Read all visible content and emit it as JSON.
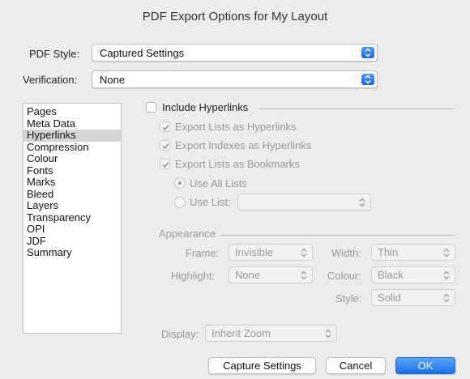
{
  "window": {
    "title": "PDF Export Options for My Layout"
  },
  "pdf_style": {
    "label": "PDF Style:",
    "value": "Captured Settings"
  },
  "verification": {
    "label": "Verification:",
    "value": "None"
  },
  "sidebar": {
    "items": [
      {
        "label": "Pages",
        "selected": false
      },
      {
        "label": "Meta Data",
        "selected": false
      },
      {
        "label": "Hyperlinks",
        "selected": true
      },
      {
        "label": "Compression",
        "selected": false
      },
      {
        "label": "Colour",
        "selected": false
      },
      {
        "label": "Fonts",
        "selected": false
      },
      {
        "label": "Marks",
        "selected": false
      },
      {
        "label": "Bleed",
        "selected": false
      },
      {
        "label": "Layers",
        "selected": false
      },
      {
        "label": "Transparency",
        "selected": false
      },
      {
        "label": "OPI",
        "selected": false
      },
      {
        "label": "JDF",
        "selected": false
      },
      {
        "label": "Summary",
        "selected": false
      }
    ]
  },
  "hyperlinks": {
    "include_label": "Include Hyperlinks",
    "include_checked": false,
    "export_lists_label": "Export Lists as Hyperlinks",
    "export_indexes_label": "Export Indexes as Hyperlinks",
    "export_bookmarks_label": "Export Lists as Bookmarks",
    "use_all_lists_label": "Use All Lists",
    "use_list_label": "Use List:",
    "use_list_value": ""
  },
  "appearance": {
    "section_label": "Appearance",
    "frame_label": "Frame:",
    "frame_value": "Invisible",
    "width_label": "Width:",
    "width_value": "Thin",
    "highlight_label": "Highlight:",
    "highlight_value": "None",
    "colour_label": "Colour:",
    "colour_value": "Black",
    "style_label": "Style:",
    "style_value": "Solid"
  },
  "display": {
    "label": "Display:",
    "value": "Inherit Zoom"
  },
  "buttons": {
    "capture": "Capture Settings",
    "cancel": "Cancel",
    "ok": "OK"
  },
  "colors": {
    "accent": "#1d6fe8",
    "selection": "#d5d5d5",
    "background": "#ececec"
  }
}
